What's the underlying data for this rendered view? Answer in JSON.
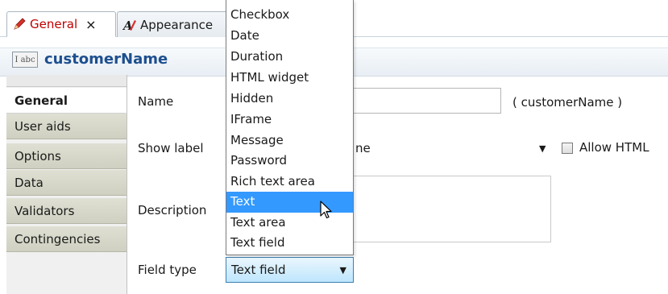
{
  "tabs": [
    {
      "label": "General",
      "icon": "pencil-icon",
      "close": "×",
      "active": true
    },
    {
      "label": "Appearance",
      "icon": "appearance-icon",
      "active": false
    }
  ],
  "header": {
    "type_badge": "I abc",
    "field_name": "customerName"
  },
  "sidebar": {
    "items": [
      {
        "label": "General",
        "active": true
      },
      {
        "label": "User aids"
      },
      {
        "label": "Options"
      },
      {
        "label": "Data"
      },
      {
        "label": "Validators"
      },
      {
        "label": "Contingencies"
      }
    ]
  },
  "form": {
    "name_label": "Name",
    "name_value": "",
    "name_hint": "( customerName )",
    "show_label_label": "Show label",
    "show_label_value": "ne",
    "allow_html_label": "Allow HTML",
    "description_label": "Description",
    "field_type_label": "Field type",
    "field_type_value": "Text field"
  },
  "dropdown": {
    "options": [
      "Checkbox",
      "Date",
      "Duration",
      "HTML widget",
      "Hidden",
      "IFrame",
      "Message",
      "Password",
      "Rich text area",
      "Text",
      "Text area",
      "Text field"
    ],
    "highlighted": "Text"
  },
  "colors": {
    "accent": "#3399ff",
    "title": "#1d4f8f",
    "tab_active_label": "#c00000"
  }
}
